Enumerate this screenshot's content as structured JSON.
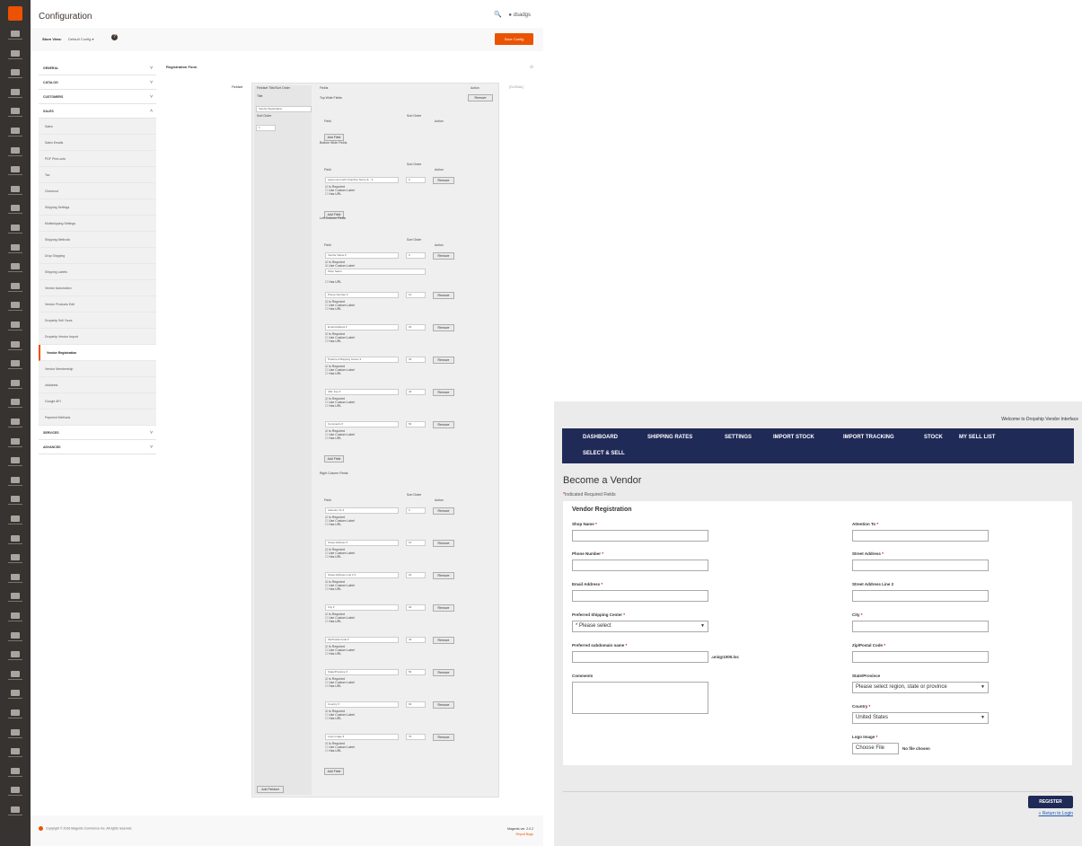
{
  "admin": {
    "page_title": "Configuration",
    "user_name": "dsadgs",
    "store_view_label": "Store View:",
    "store_view_value": "Default Config",
    "save_config": "Save Config",
    "sections": [
      "GENERAL",
      "CATALOG",
      "CUSTOMERS",
      "SALES"
    ],
    "sales_items": [
      "Sales",
      "Sales Emails",
      "PDF Print-outs",
      "Tax",
      "Checkout",
      "Shipping Settings",
      "Multishipping Settings",
      "Shipping Methods",
      "Drop Shipping",
      "Shipping Labels",
      "Vendor Automation",
      "Vendor Products Edit",
      "Dropship Sell Yours",
      "Dropship Vendor Import",
      "Vendor Registration",
      "Vendor Membership",
      "uMarkets",
      "Google API",
      "Payment Methods"
    ],
    "active_item": "Vendor Registration",
    "after_sections": [
      "SERVICES",
      "ADVANCED"
    ],
    "reg_form_title": "Registration Form",
    "fieldset_label": "Fieldset",
    "scope_label": "[GLOBAL]",
    "col_headers": {
      "fieldset_title": "Fieldset Title/Sort Order",
      "fields": "Fields",
      "action": "Action"
    },
    "title_label": "Title",
    "title_value": "Vendor Registration",
    "sort_order_label": "Sort Order",
    "sort_order_value": "1",
    "delete_label": "Remove",
    "add_field": "Add Field",
    "add_fieldset": "Add Fieldset",
    "field_col": "Field",
    "sort_col": "Sort Order",
    "action_col": "Action",
    "is_required": "Is Required",
    "use_custom_label": "Use Custom Label",
    "has_url": "Has URL",
    "groups": [
      {
        "title": "Top Wide Fields",
        "fields": []
      },
      {
        "title": "Bottom Wide Fields",
        "fields": [
          {
            "name": "Agreement with Dropship Terms &...",
            "sort": "0"
          }
        ]
      },
      {
        "title": "Left Column Fields",
        "fields": [
          {
            "name": "Vendor Name",
            "sort": "0",
            "custom": "Shop Name"
          },
          {
            "name": "Phone Number",
            "sort": "10"
          },
          {
            "name": "Email Address",
            "sort": "20"
          },
          {
            "name": "Preferred Shipping Center",
            "sort": "30"
          },
          {
            "name": "URL Key",
            "sort": "40"
          },
          {
            "name": "Comments",
            "sort": "50"
          }
        ]
      },
      {
        "title": "Right Column Fields",
        "fields": [
          {
            "name": "Attention To",
            "sort": "0"
          },
          {
            "name": "Street Address",
            "sort": "10"
          },
          {
            "name": "Street Address Line 2",
            "sort": "20"
          },
          {
            "name": "City",
            "sort": "30"
          },
          {
            "name": "Zip/Postal Code",
            "sort": "40"
          },
          {
            "name": "State/Province",
            "sort": "50"
          },
          {
            "name": "Country",
            "sort": "60"
          },
          {
            "name": "Logo Image",
            "sort": "70"
          }
        ]
      }
    ],
    "footer_copyright": "Copyright © 2016 Magento Commerce Inc. All rights reserved.",
    "footer_version": "Magento ver. 2.0.2",
    "footer_report": "Report Bugs"
  },
  "vendor": {
    "welcome": "Welcome to Dropship Vendor Interface",
    "nav": [
      "DASHBOARD",
      "SHIPPING RATES",
      "SETTINGS",
      "IMPORT STOCK",
      "IMPORT TRACKING",
      "STOCK",
      "MY SELL LIST",
      "SELECT & SELL"
    ],
    "page_title": "Become a Vendor",
    "required_note": "Indicated Required Fields",
    "legend": "Vendor Registration",
    "left": [
      {
        "label": "Shop Name",
        "req": true,
        "type": "text",
        "value": ""
      },
      {
        "label": "Phone Number",
        "req": true,
        "type": "text",
        "value": ""
      },
      {
        "label": "Email Address",
        "req": true,
        "type": "text",
        "value": ""
      },
      {
        "label": "Preferred Shipping Center",
        "req": true,
        "type": "select",
        "value": "* Please select"
      },
      {
        "label": "Preferred subdomain name",
        "req": true,
        "type": "text",
        "value": "",
        "suffix": ".uniqy1000.loc"
      },
      {
        "label": "Comments",
        "req": false,
        "type": "textarea",
        "value": ""
      }
    ],
    "right": [
      {
        "label": "Attention To",
        "req": true,
        "type": "text",
        "value": ""
      },
      {
        "label": "Street Address",
        "req": true,
        "type": "text",
        "value": ""
      },
      {
        "label": "Street Address Line 2",
        "req": false,
        "type": "text",
        "value": ""
      },
      {
        "label": "City",
        "req": true,
        "type": "text",
        "value": ""
      },
      {
        "label": "Zip/Postal Code",
        "req": true,
        "type": "text",
        "value": ""
      },
      {
        "label": "State/Province",
        "req": false,
        "type": "select",
        "value": "Please select region, state or province"
      },
      {
        "label": "Country",
        "req": true,
        "type": "select",
        "value": "United States"
      },
      {
        "label": "Logo Image",
        "req": true,
        "type": "file",
        "button": "Choose File",
        "value": "No file chosen"
      }
    ],
    "register": "REGISTER",
    "return_login": "« Return to Login"
  },
  "colors": {
    "magento_orange": "#eb5202",
    "vendor_nav": "#202a57",
    "admin_nav": "#373330"
  }
}
